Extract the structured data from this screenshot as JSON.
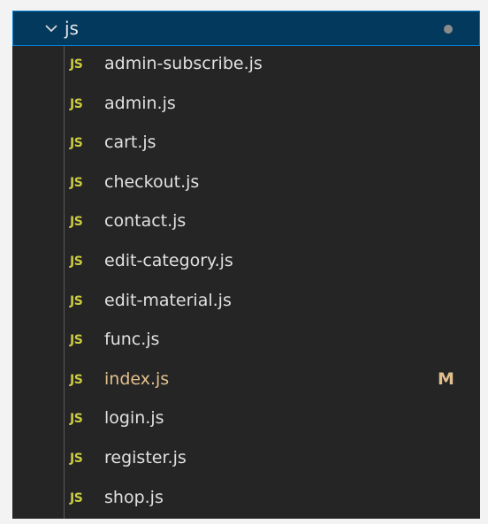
{
  "folder": {
    "name": "js",
    "expanded": true
  },
  "files": [
    {
      "icon": "JS",
      "name": "admin-subscribe.js",
      "status": ""
    },
    {
      "icon": "JS",
      "name": "admin.js",
      "status": ""
    },
    {
      "icon": "JS",
      "name": "cart.js",
      "status": ""
    },
    {
      "icon": "JS",
      "name": "checkout.js",
      "status": ""
    },
    {
      "icon": "JS",
      "name": "contact.js",
      "status": ""
    },
    {
      "icon": "JS",
      "name": "edit-category.js",
      "status": ""
    },
    {
      "icon": "JS",
      "name": "edit-material.js",
      "status": ""
    },
    {
      "icon": "JS",
      "name": "func.js",
      "status": ""
    },
    {
      "icon": "JS",
      "name": "index.js",
      "status": "M"
    },
    {
      "icon": "JS",
      "name": "login.js",
      "status": ""
    },
    {
      "icon": "JS",
      "name": "register.js",
      "status": ""
    },
    {
      "icon": "JS",
      "name": "shop.js",
      "status": ""
    }
  ],
  "colors": {
    "panel_background": "#252526",
    "selected_row": "#04395e",
    "focus_border": "#007fd4",
    "js_icon": "#cbcb41",
    "modified_text": "#e2c08d"
  }
}
